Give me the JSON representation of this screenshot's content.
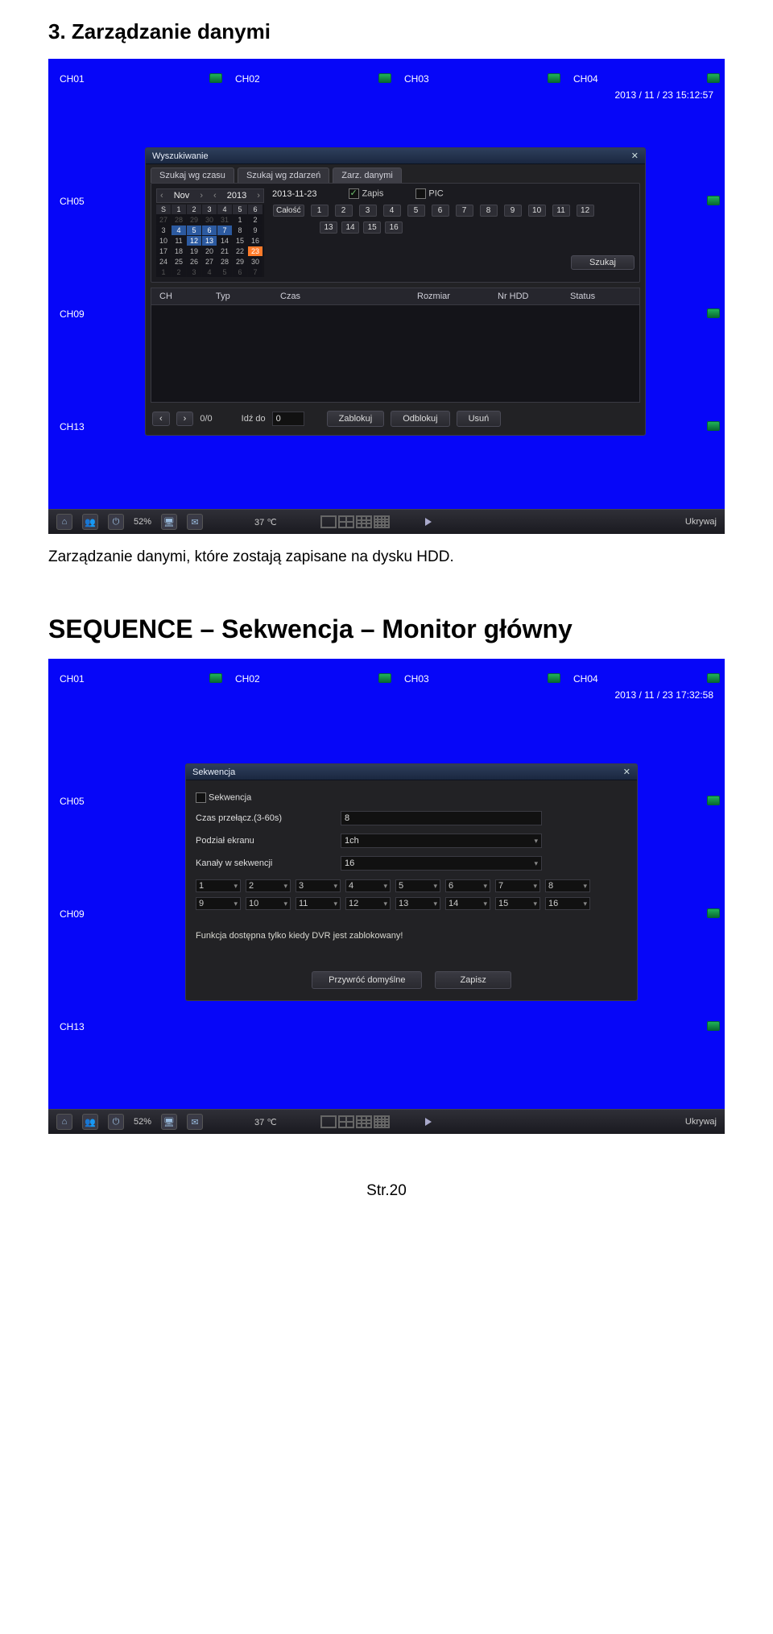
{
  "doc": {
    "heading1": "3. Zarządzanie danymi",
    "caption1": "Zarządzanie danymi, które zostają zapisane na dysku HDD.",
    "heading2": "SEQUENCE – Sekwencja – Monitor główny",
    "page_num": "Str.20"
  },
  "screen1": {
    "channels_top": [
      "CH01",
      "CH02",
      "CH03",
      "CH04"
    ],
    "channels_side": [
      "CH05",
      "CH09",
      "CH13"
    ],
    "timestamp": "2013 / 11 / 23 15:12:57",
    "dialog_title": "Wyszukiwanie",
    "tabs": [
      "Szukaj wg czasu",
      "Szukaj wg zdarzeń",
      "Zarz. danymi"
    ],
    "cal_month": "Nov",
    "cal_year": "2013",
    "cal_headers": [
      "S",
      "1",
      "2",
      "3",
      "4",
      "5",
      "6"
    ],
    "cal_rows": [
      [
        "27",
        "28",
        "29",
        "30",
        "31",
        "1",
        "2"
      ],
      [
        "3",
        "4",
        "5",
        "6",
        "7",
        "8",
        "9"
      ],
      [
        "10",
        "11",
        "12",
        "13",
        "14",
        "15",
        "16"
      ],
      [
        "17",
        "18",
        "19",
        "20",
        "21",
        "22",
        "23"
      ],
      [
        "24",
        "25",
        "26",
        "27",
        "28",
        "29",
        "30"
      ],
      [
        "1",
        "2",
        "3",
        "4",
        "5",
        "6",
        "7"
      ]
    ],
    "date_line": "2013-11-23",
    "zapis": "Zapis",
    "pic": "PIC",
    "calosc": "Całość",
    "nums_row1": [
      "1",
      "2",
      "3",
      "4",
      "5",
      "6",
      "7",
      "8",
      "9",
      "10",
      "11",
      "12"
    ],
    "nums_row2": [
      "13",
      "14",
      "15",
      "16"
    ],
    "szukaj": "Szukaj",
    "table_headers": [
      "CH",
      "Typ",
      "Czas",
      "Rozmiar",
      "Nr HDD",
      "Status"
    ],
    "pager": "0/0",
    "idz_do": "Idź do",
    "idz_val": "0",
    "zablokuj": "Zablokuj",
    "odblokuj": "Odblokuj",
    "usun": "Usuń",
    "bottombar": {
      "usage": "52%",
      "temp": "37 ℃",
      "hide": "Ukrywaj"
    }
  },
  "screen2": {
    "channels_top": [
      "CH01",
      "CH02",
      "CH03",
      "CH04"
    ],
    "channels_side": [
      "CH05",
      "CH09",
      "CH13"
    ],
    "timestamp": "2013 / 11 / 23 17:32:58",
    "dialog_title": "Sekwencja",
    "chk_label": "Sekwencja",
    "rows": {
      "r1_label": "Czas przełącz.(3-60s)",
      "r1_val": "8",
      "r2_label": "Podział ekranu",
      "r2_val": "1ch",
      "r3_label": "Kanały w sekwencji",
      "r3_val": "16"
    },
    "seq_nums": [
      "1",
      "2",
      "3",
      "4",
      "5",
      "6",
      "7",
      "8",
      "9",
      "10",
      "11",
      "12",
      "13",
      "14",
      "15",
      "16"
    ],
    "note": "Funkcja dostępna tylko kiedy DVR jest zablokowany!",
    "btn_default": "Przywróć domyślne",
    "btn_save": "Zapisz",
    "bottombar": {
      "usage": "52%",
      "temp": "37 ℃",
      "hide": "Ukrywaj"
    }
  }
}
